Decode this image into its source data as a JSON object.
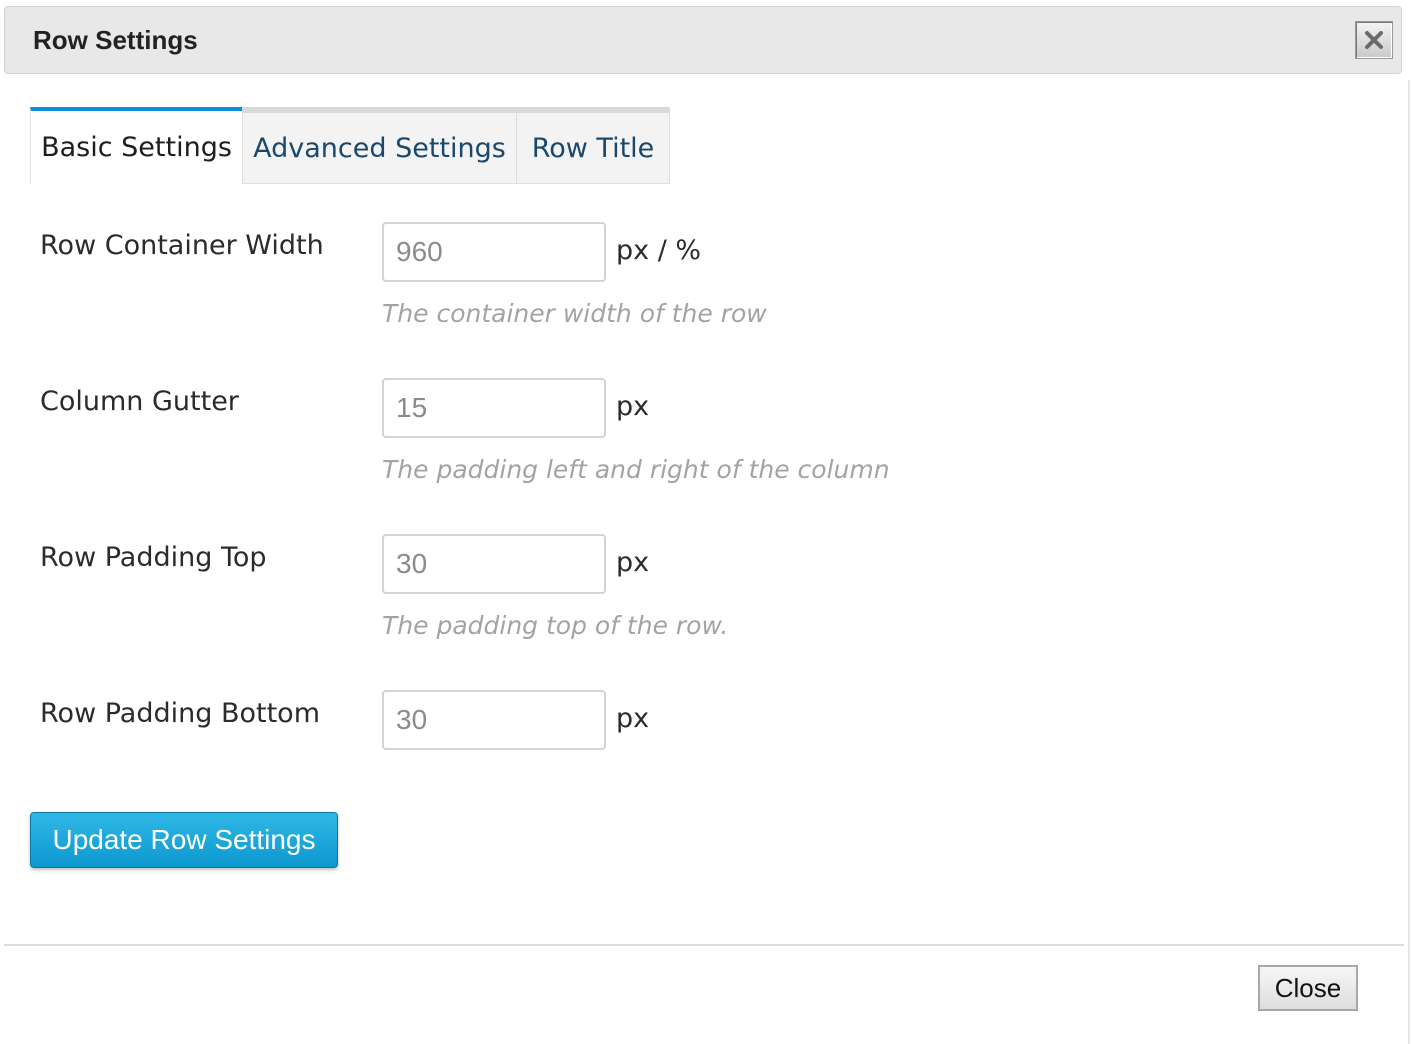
{
  "dialog": {
    "title": "Row Settings",
    "close_icon": "close-x-icon"
  },
  "tabs": [
    {
      "label": "Basic Settings",
      "active": true
    },
    {
      "label": "Advanced Settings",
      "active": false
    },
    {
      "label": "Row Title",
      "active": false
    }
  ],
  "fields": [
    {
      "label": "Row Container Width",
      "value": "960",
      "unit": "px / %",
      "help": "The container width of the row"
    },
    {
      "label": "Column Gutter",
      "value": "15",
      "unit": "px",
      "help": "The padding left and right of the column"
    },
    {
      "label": "Row Padding Top",
      "value": "30",
      "unit": "px",
      "help": "The padding top of the row."
    },
    {
      "label": "Row Padding Bottom",
      "value": "30",
      "unit": "px",
      "help": ""
    }
  ],
  "actions": {
    "update_label": "Update Row Settings",
    "close_label": "Close"
  },
  "colors": {
    "accent": "#0b8fd6",
    "button": "#1aa6db",
    "tab_text": "#19486b",
    "help_text": "#a3a3a3"
  }
}
